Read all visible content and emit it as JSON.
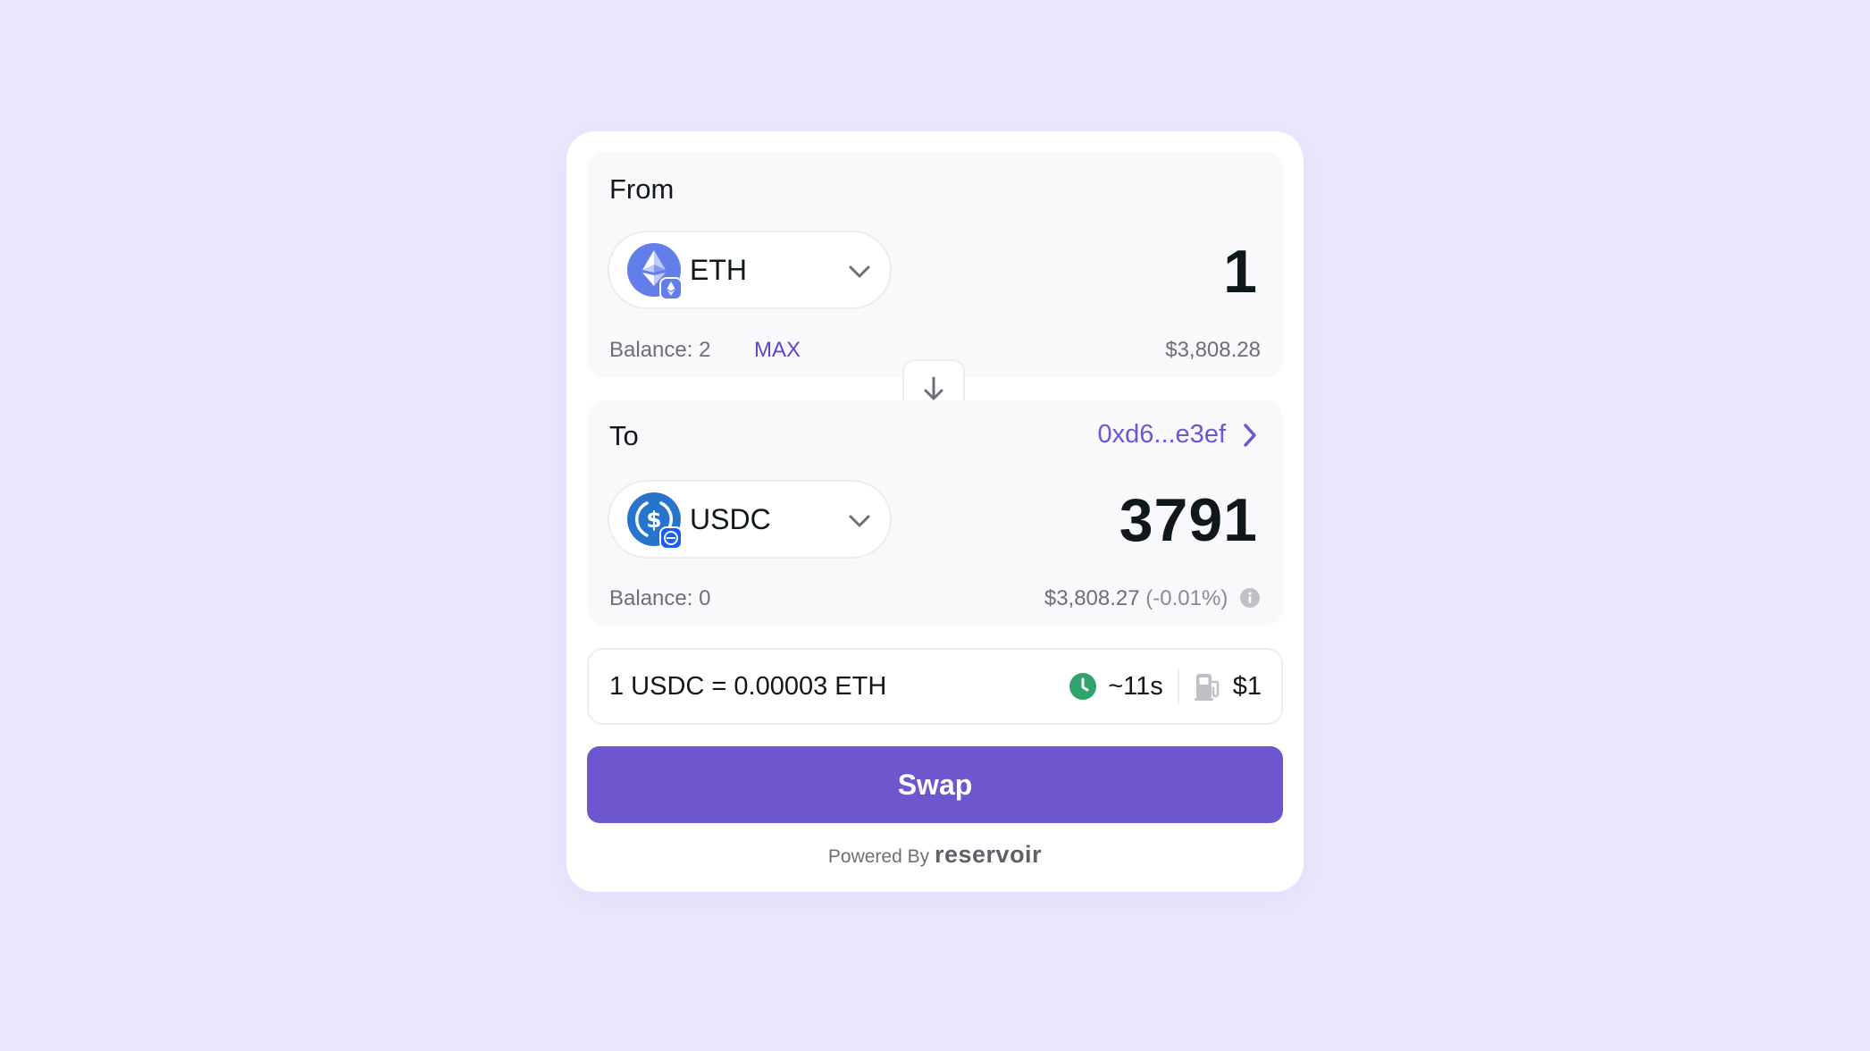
{
  "widget": {
    "from": {
      "label": "From",
      "token": {
        "symbol": "ETH",
        "icon": "ethereum-icon",
        "chain_icon": "ethereum-chain-badge-icon"
      },
      "amount": "1",
      "balance_text": "Balance: 2",
      "max_label": "MAX",
      "usd_value": "$3,808.28"
    },
    "switch_icon": "arrow-down-icon",
    "to": {
      "label": "To",
      "recipient": "0xd6...e3ef",
      "token": {
        "symbol": "USDC",
        "icon": "usdc-icon",
        "chain_icon": "usdc-chain-badge-icon"
      },
      "amount": "3791",
      "balance_text": "Balance: 0",
      "usd_value": "$3,808.27",
      "price_impact": "(-0.01%)"
    },
    "quote": {
      "rate": "1 USDC = 0.00003 ETH",
      "time": "~11s",
      "gas": "$1",
      "time_icon": "clock-icon",
      "gas_icon": "gas-pump-icon"
    },
    "swap_label": "Swap",
    "powered_by": "Powered By",
    "brand": "reservoir"
  },
  "colors": {
    "background": "#ebe7fe",
    "accent": "#6e56cf",
    "max_link": "#5b47c7",
    "eth": "#627eea",
    "usdc": "#2775ca",
    "clock_green": "#30a46c"
  }
}
